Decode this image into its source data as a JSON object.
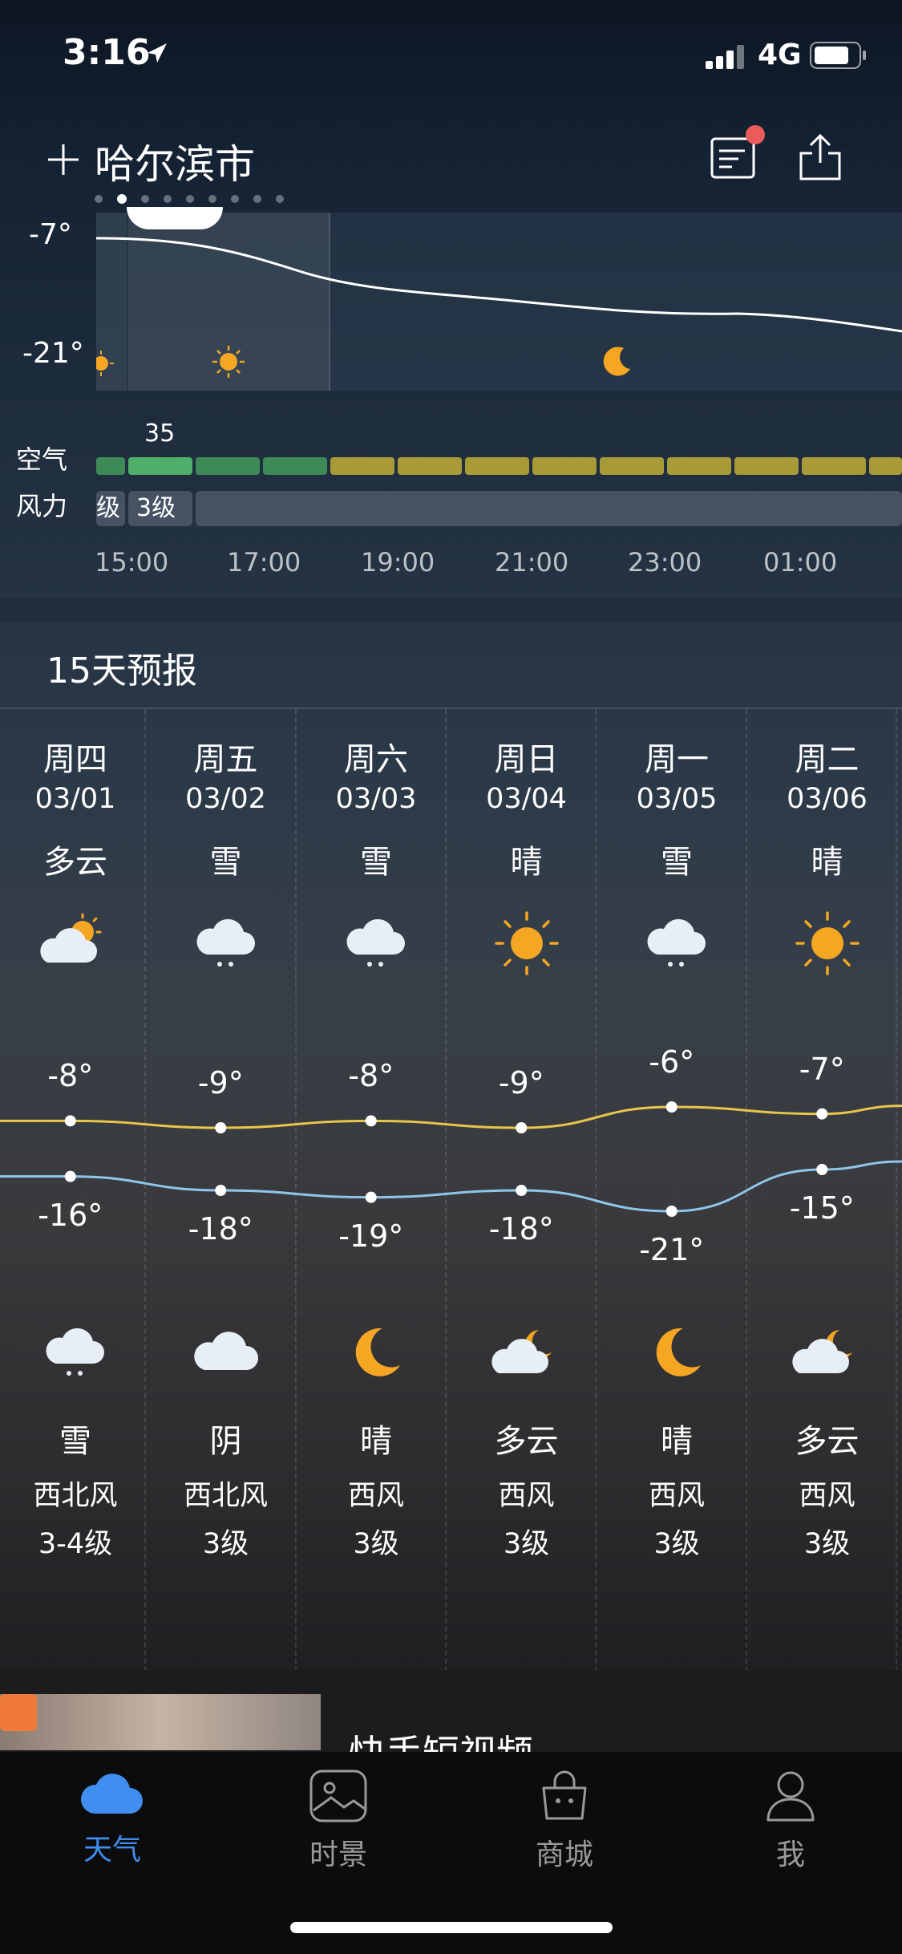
{
  "status_bar": {
    "time": "3:16",
    "network": "4G"
  },
  "header": {
    "city": "哈尔滨市"
  },
  "hourly": {
    "high_label": "-7°",
    "low_label": "-21°",
    "air_label": "空气",
    "wind_label": "风力",
    "aqi_value": "35",
    "wind_partial": "级",
    "wind_value": "3级",
    "hours": [
      "15:00",
      "17:00",
      "19:00",
      "21:00",
      "23:00",
      "01:00"
    ],
    "colors": {
      "aqi_good": "#4fae6a",
      "aqi_good_dim": "#3d8a57",
      "aqi_moderate": "#a89a36"
    }
  },
  "forecast": {
    "title": "15天预报",
    "days": [
      {
        "day": "周四",
        "date": "03/01",
        "day_weather": "多云",
        "day_icon": "partly-cloudy-icon",
        "high": "-8°",
        "low": "-16°",
        "night_icon": "snow-cloud-icon",
        "night_weather": "雪",
        "wind_dir": "西北风",
        "wind_level": "3-4级"
      },
      {
        "day": "周五",
        "date": "03/02",
        "day_weather": "雪",
        "day_icon": "snow-cloud-icon",
        "high": "-9°",
        "low": "-18°",
        "night_icon": "cloud-icon",
        "night_weather": "阴",
        "wind_dir": "西北风",
        "wind_level": "3级"
      },
      {
        "day": "周六",
        "date": "03/03",
        "day_weather": "雪",
        "day_icon": "snow-cloud-icon",
        "high": "-8°",
        "low": "-19°",
        "night_icon": "moon-icon",
        "night_weather": "晴",
        "wind_dir": "西风",
        "wind_level": "3级"
      },
      {
        "day": "周日",
        "date": "03/04",
        "day_weather": "晴",
        "day_icon": "sun-icon",
        "high": "-9°",
        "low": "-18°",
        "night_icon": "cloudy-moon-icon",
        "night_weather": "多云",
        "wind_dir": "西风",
        "wind_level": "3级"
      },
      {
        "day": "周一",
        "date": "03/05",
        "day_weather": "雪",
        "day_icon": "snow-cloud-icon",
        "high": "-6°",
        "low": "-21°",
        "night_icon": "moon-icon",
        "night_weather": "晴",
        "wind_dir": "西风",
        "wind_level": "3级"
      },
      {
        "day": "周二",
        "date": "03/06",
        "day_weather": "晴",
        "day_icon": "sun-icon",
        "high": "-7°",
        "low": "-15°",
        "night_icon": "cloudy-moon-icon",
        "night_weather": "多云",
        "wind_dir": "西风",
        "wind_level": "3级"
      }
    ],
    "colors": {
      "high_line": "#e8c64a",
      "low_line": "#8fc6ec"
    }
  },
  "ad": {
    "title": "快手短视频"
  },
  "tabbar": {
    "tabs": [
      {
        "label": "天气",
        "icon": "cloud-icon",
        "active": true
      },
      {
        "label": "时景",
        "icon": "image-icon",
        "active": false
      },
      {
        "label": "商城",
        "icon": "bag-icon",
        "active": false
      },
      {
        "label": "我",
        "icon": "person-icon",
        "active": false
      }
    ],
    "colors": {
      "active": "#3f8ef0",
      "inactive": "#9a9a9d"
    }
  }
}
